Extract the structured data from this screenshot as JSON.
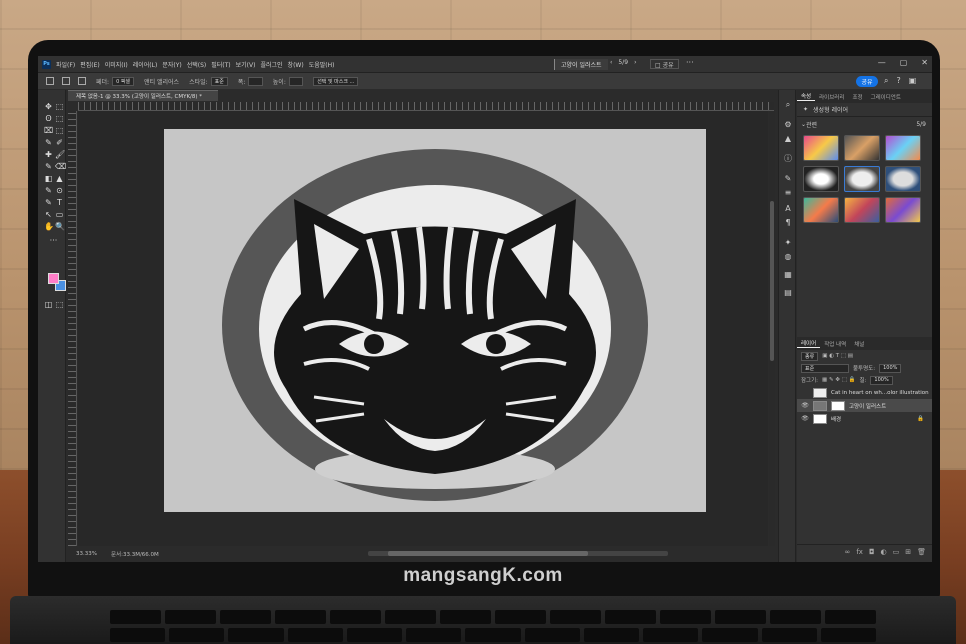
{
  "watermark": "mangsangK.com",
  "ps": {
    "logo": "Ps",
    "menu": [
      "파일(F)",
      "편집(E)",
      "이미지(I)",
      "레이어(L)",
      "문자(Y)",
      "선택(S)",
      "필터(T)",
      "보기(V)",
      "플러그인",
      "창(W)",
      "도움말(H)"
    ],
    "center_tab": "고양이 일러스트",
    "pager": {
      "prev": "‹",
      "page": "5/9",
      "next": "›"
    },
    "share_mini": "□ 공유",
    "more": "···",
    "window_controls": [
      "—",
      "▢",
      "✕"
    ],
    "options": {
      "mode_label": "페더:",
      "mode_value": "0 픽셀",
      "antialias": "앤티 앨리어스",
      "style_label": "스타일:",
      "style_value": "표준",
      "width_label": "폭:",
      "height_label": "높이:",
      "select_mask": "선택 및 마스크 ..."
    },
    "share_button": "공유",
    "toolbar_icons": [
      "✥",
      "⬚",
      "ʘ",
      "⬚",
      "⌧",
      "⬚",
      "✎",
      "✐",
      "✚",
      "🖌",
      "✎",
      "⌫",
      "◧",
      "▲",
      "✎",
      "⊙",
      "✎",
      "T",
      "↖",
      "▭",
      "✋",
      "🔍",
      "···",
      "◫",
      "⬚"
    ],
    "doc_tab": "제목 없음-1 @ 33.3% (고양이 일러스트, CMYK/8) *",
    "status": {
      "zoom": "33.33%",
      "info": "문서:33.3M/66.0M"
    },
    "panel_tabs": [
      "속성",
      "라이브러리",
      "조정",
      "그레이디언트"
    ],
    "gen_layer": "생성형 레이어",
    "related": {
      "label": "관련",
      "count": "5/9"
    },
    "layer_tabs": [
      "레이어",
      "작업 내역",
      "채널"
    ],
    "layer_controls": {
      "kind": "종류",
      "blend": "표준",
      "opacity_label": "불투명도:",
      "opacity": "100%",
      "lock_label": "잠그기:",
      "fill_label": "칠:",
      "fill": "100%"
    },
    "layers": [
      {
        "name": "Cat in heart on wh...olor illustration",
        "visible": ""
      },
      {
        "name": "고양이 일러스트",
        "visible": "👁"
      },
      {
        "name": "배경",
        "visible": "👁",
        "lock": "🔒"
      }
    ],
    "footer_icons": [
      "∞",
      "fx",
      "◘",
      "◐",
      "▭",
      "⊞",
      "🗑"
    ]
  }
}
